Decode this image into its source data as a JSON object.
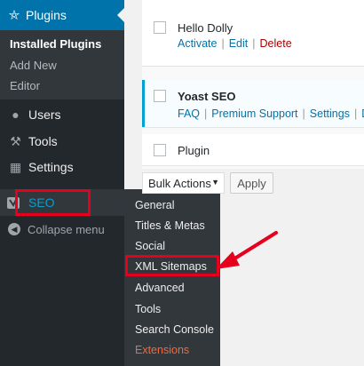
{
  "sidebar": {
    "plugins_label": "Plugins",
    "submenu": [
      "Installed Plugins",
      "Add New",
      "Editor"
    ],
    "menu": [
      {
        "label": "Users",
        "icon": "users-icon"
      },
      {
        "label": "Tools",
        "icon": "wrench-icon"
      },
      {
        "label": "Settings",
        "icon": "settings-icon"
      }
    ],
    "seo_label": "SEO",
    "collapse_label": "Collapse menu"
  },
  "seo_flyout": [
    "General",
    "Titles & Metas",
    "Social",
    "XML Sitemaps",
    "Advanced",
    "Tools",
    "Search Console",
    "Extensions"
  ],
  "plugins": [
    {
      "name": "Hello Dolly",
      "actions": [
        "Activate",
        "Edit",
        "Delete"
      ]
    },
    {
      "name": "Yoast SEO",
      "actions": [
        "FAQ",
        "Premium Support",
        "Settings",
        "D"
      ]
    },
    {
      "name": "Plugin"
    }
  ],
  "bulk_actions": {
    "selected": "Bulk Actions",
    "caret": "▼"
  },
  "apply_label": "Apply",
  "colors": {
    "admin_blue": "#0073aa",
    "sidebar": "#23282d",
    "highlight_red": "#e6001e",
    "extensions_orange": "#f0693c"
  }
}
